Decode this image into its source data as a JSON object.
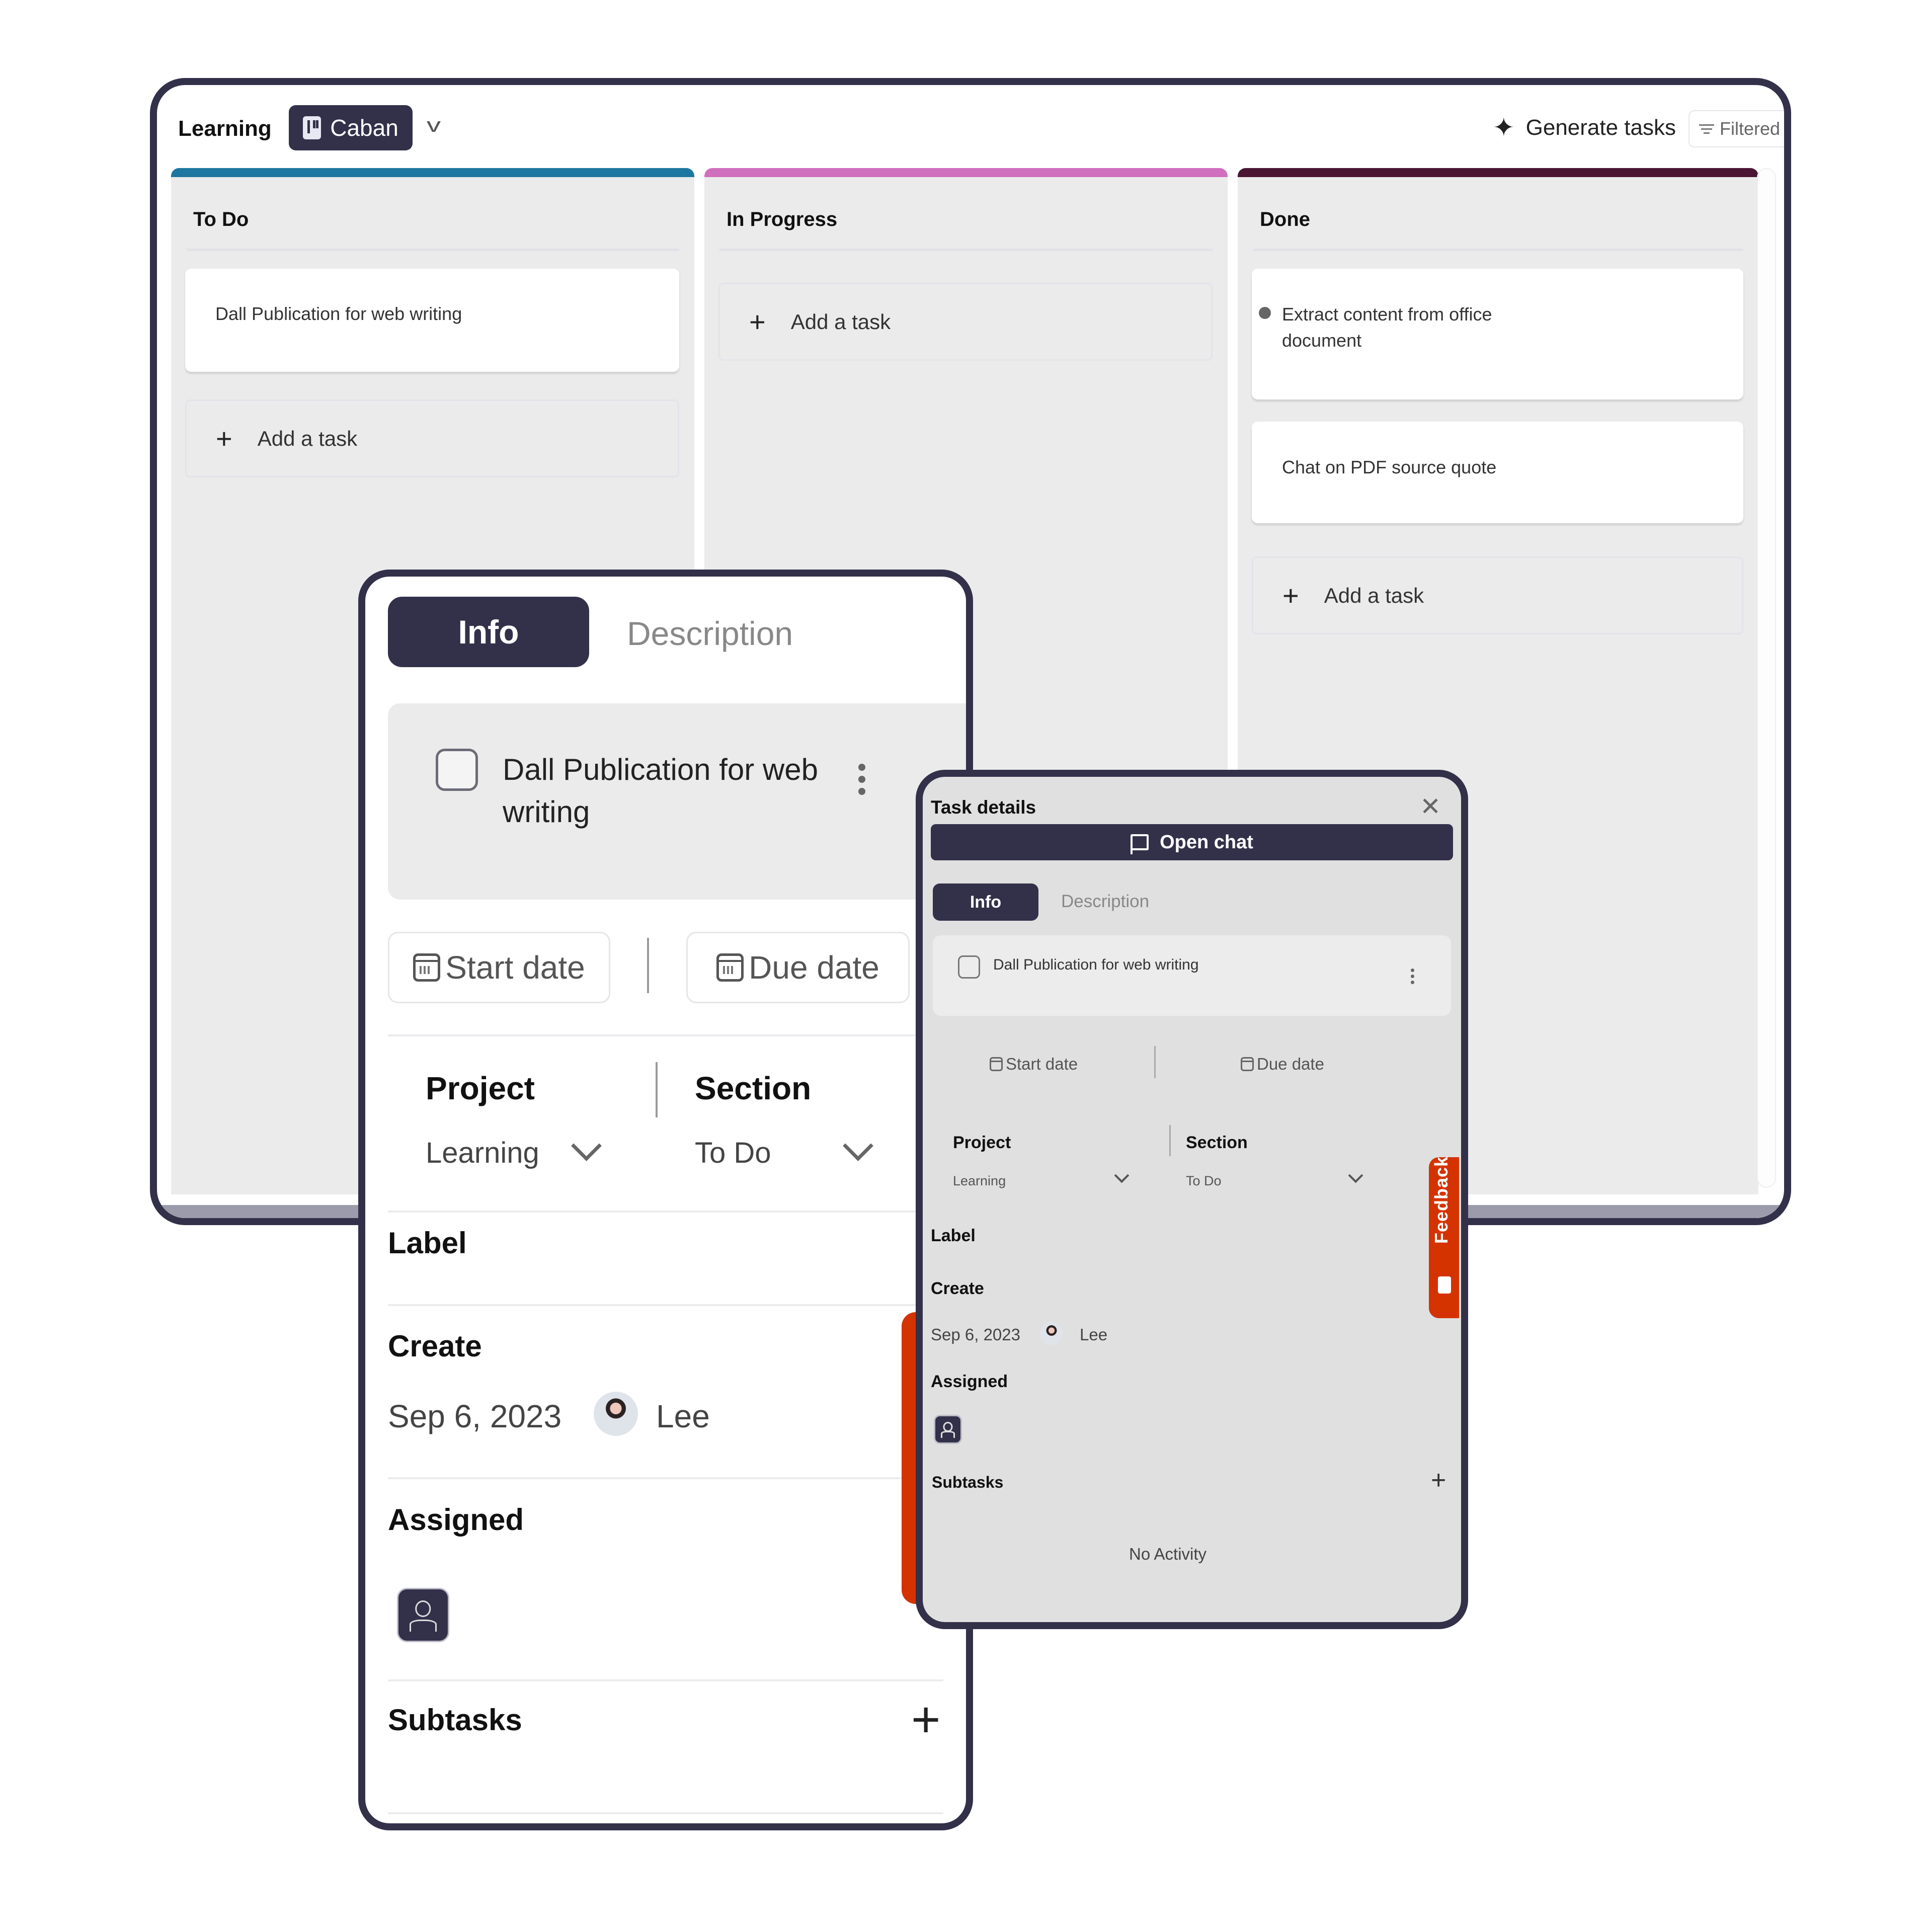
{
  "board": {
    "project_name": "Learning",
    "view_label": "Caban",
    "view_icon": "kanban-icon",
    "generate_tasks_label": "Generate tasks",
    "filter_label": "Filtered",
    "columns": [
      {
        "title": "To Do",
        "accent_color": "#1d77a0",
        "tasks": [
          {
            "text": "Dall Publication for web writing"
          }
        ],
        "add_task_label": "Add a task"
      },
      {
        "title": "In Progress",
        "accent_color": "#d06fbd",
        "tasks": [],
        "add_task_label": "Add a task"
      },
      {
        "title": "Done",
        "accent_color": "#4a1634",
        "tasks": [
          {
            "text": "Extract content from office document"
          },
          {
            "text": "Chat on PDF source quote"
          }
        ],
        "add_task_label": "Add a task"
      }
    ]
  },
  "info_panel": {
    "tabs": {
      "info": "Info",
      "description": "Description"
    },
    "task_title": "Dall Publication for web writing",
    "start_date_label": "Start date",
    "due_date_label": "Due date",
    "project_label": "Project",
    "project_value": "Learning",
    "section_label": "Section",
    "section_value": "To Do",
    "label_heading": "Label",
    "create_heading": "Create",
    "created_date": "Sep 6, 2023",
    "creator_name": "Lee",
    "assigned_heading": "Assigned",
    "subtasks_heading": "Subtasks"
  },
  "details_panel": {
    "title": "Task details",
    "open_chat_label": "Open chat",
    "tabs": {
      "info": "Info",
      "description": "Description"
    },
    "task_title": "Dall Publication for web writing",
    "start_date_label": "Start date",
    "due_date_label": "Due date",
    "project_label": "Project",
    "project_value": "Learning",
    "section_label": "Section",
    "section_value": "To Do",
    "label_heading": "Label",
    "create_heading": "Create",
    "created_date": "Sep 6, 2023",
    "creator_name": "Lee",
    "assigned_heading": "Assigned",
    "subtasks_heading": "Subtasks",
    "no_activity_text": "No Activity",
    "feedback_label": "Feedback"
  },
  "colors": {
    "primary": "#33304a",
    "feedback": "#d43300",
    "column_bg": "#ebebeb"
  }
}
